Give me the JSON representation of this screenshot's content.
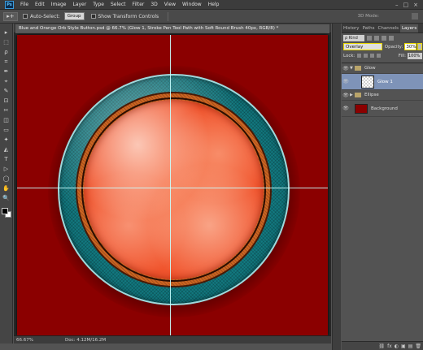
{
  "menubar": {
    "logo": "Ps",
    "items": [
      "File",
      "Edit",
      "Image",
      "Layer",
      "Type",
      "Select",
      "Filter",
      "3D",
      "View",
      "Window",
      "Help"
    ],
    "window_controls": [
      "–",
      "□",
      "×"
    ]
  },
  "options": {
    "tool_glyph": "▸+",
    "auto_select_label": "Auto-Select:",
    "auto_select_value": "Group",
    "transform_label": "Show Transform Controls",
    "mode_label": "3D Mode:"
  },
  "document": {
    "tab_title": "Blue and Orange Orb Style Button.psd @ 66.7% (Glow 1, Stroke Pen Tool Path with Soft Round Brush 40px, RGB/8) *",
    "zoom": "66.67%",
    "doc_size": "Doc: 4.12M/16.2M"
  },
  "panel": {
    "tabs": [
      "History",
      "Paths",
      "Channels",
      "Layers"
    ],
    "active_tab": "Layers",
    "kind_label": "ρ Kind",
    "blend_mode": "Overlay",
    "opacity_label": "Opacity:",
    "opacity_value": "30%",
    "lock_label": "Lock:",
    "fill_label": "Fill:",
    "fill_value": "100%",
    "layers": [
      {
        "name": "Glow",
        "type": "group"
      },
      {
        "name": "Glow 1",
        "type": "layer"
      },
      {
        "name": "Ellipse",
        "type": "group"
      },
      {
        "name": "Background",
        "type": "background"
      }
    ],
    "bottom_icons": [
      "⛓",
      "fx",
      "◐",
      "▣",
      "▤",
      "🗑"
    ]
  },
  "toolbar": {
    "tools": [
      "▸",
      "⬚",
      "ρ",
      "⌗",
      "✒",
      "⌖",
      "✎",
      "⊡",
      "✂",
      "◫",
      "▭",
      "✦",
      "◭",
      "T",
      "▷",
      "◯",
      "✋",
      "🔍"
    ]
  },
  "colors": {
    "canvas_bg": "#8b0000",
    "teal": "#137c83",
    "orange": "#f0532c",
    "selection": "#7e93b8"
  }
}
